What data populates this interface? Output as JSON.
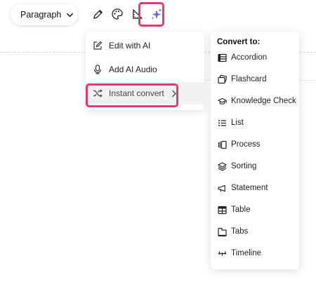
{
  "paragraph_selector": {
    "label": "Paragraph"
  },
  "toolbar": {
    "buttons": [
      {
        "icon": "pencil-icon"
      },
      {
        "icon": "palette-icon"
      },
      {
        "icon": "ruler-triangle-icon"
      },
      {
        "icon": "sparkles-icon",
        "color": "#6b6bd8"
      }
    ]
  },
  "ai_menu": {
    "items": [
      {
        "label": "Edit with AI",
        "icon": "edit-icon"
      },
      {
        "label": "Add AI Audio",
        "icon": "mic-icon"
      },
      {
        "label": "Instant convert",
        "icon": "shuffle-icon",
        "has_submenu": true
      }
    ]
  },
  "convert_menu": {
    "title": "Convert to:",
    "items": [
      {
        "label": "Accordion",
        "icon": "accordion-icon"
      },
      {
        "label": "Flashcard",
        "icon": "flashcard-icon"
      },
      {
        "label": "Knowledge Check",
        "icon": "graduation-cap-icon"
      },
      {
        "label": "List",
        "icon": "list-icon"
      },
      {
        "label": "Process",
        "icon": "process-icon"
      },
      {
        "label": "Sorting",
        "icon": "layers-icon"
      },
      {
        "label": "Statement",
        "icon": "megaphone-icon"
      },
      {
        "label": "Table",
        "icon": "table-icon"
      },
      {
        "label": "Tabs",
        "icon": "tabs-icon"
      },
      {
        "label": "Timeline",
        "icon": "timeline-icon"
      }
    ]
  },
  "highlight_color": "#e8386d"
}
